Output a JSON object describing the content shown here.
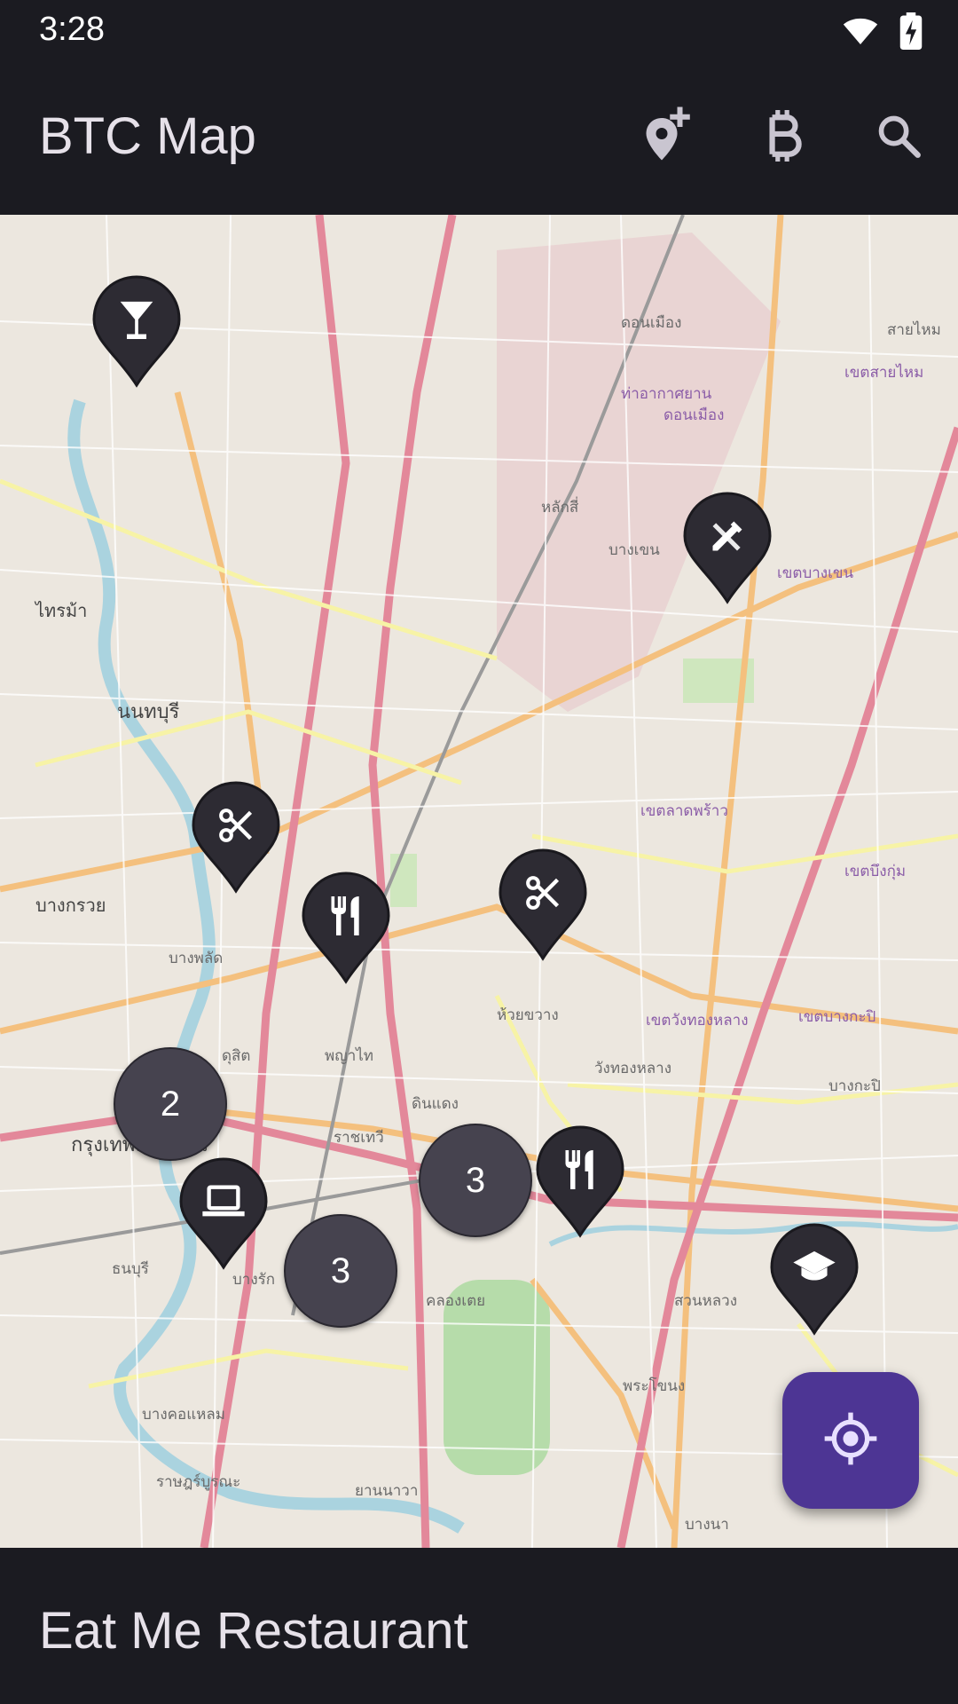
{
  "status_bar": {
    "time": "3:28",
    "icons": [
      "wifi-icon",
      "battery-charging-icon"
    ]
  },
  "app_bar": {
    "title": "BTC Map",
    "actions": [
      {
        "name": "add-place-icon"
      },
      {
        "name": "bitcoin-icon"
      },
      {
        "name": "search-icon"
      }
    ]
  },
  "map": {
    "pins": [
      {
        "icon": "cocktail-icon"
      },
      {
        "icon": "design-tools-icon"
      },
      {
        "icon": "scissors-icon"
      },
      {
        "icon": "restaurant-icon"
      },
      {
        "icon": "scissors-icon"
      },
      {
        "icon": "laptop-icon"
      },
      {
        "icon": "restaurant-icon"
      },
      {
        "icon": "graduation-cap-icon"
      }
    ],
    "clusters": [
      {
        "count": "2"
      },
      {
        "count": "3"
      },
      {
        "count": "3"
      }
    ],
    "labels": [
      "ดอนเมือง",
      "หลักสี่",
      "บางเขน",
      "ท่าอากาศยาน",
      "ดอนเมือง",
      "นนทบุรี",
      "ไทรม้า",
      "บางกรวย",
      "บางพลัด",
      "ดุสิต",
      "พญาไท",
      "ห้วยขวาง",
      "วังทองหลาง",
      "ดินแดง",
      "ราชเทวี",
      "คลองเตย",
      "พระโขนง",
      "สวนหลวง",
      "บางกะปิ",
      "สายไหม",
      "เขตสายไหม",
      "เขตบางเขน",
      "เขตลาดพร้าว",
      "เขตบึงกุ่ม",
      "เขตวังทองหลาง",
      "เขตบางกะปิ",
      "ธนบุรี",
      "บางรัก",
      "บางคอแหลม",
      "ยานนาวา",
      "บางนา",
      "ราษฎร์บูรณะ",
      "กรุงเทพมหานคร"
    ],
    "locate_button": "my-location-icon"
  },
  "bottom_sheet": {
    "title": "Eat Me Restaurant"
  },
  "colors": {
    "background": "#1b1b21",
    "fab": "#4d3594",
    "pin": "#2d2b33",
    "cluster": "#46434f"
  }
}
